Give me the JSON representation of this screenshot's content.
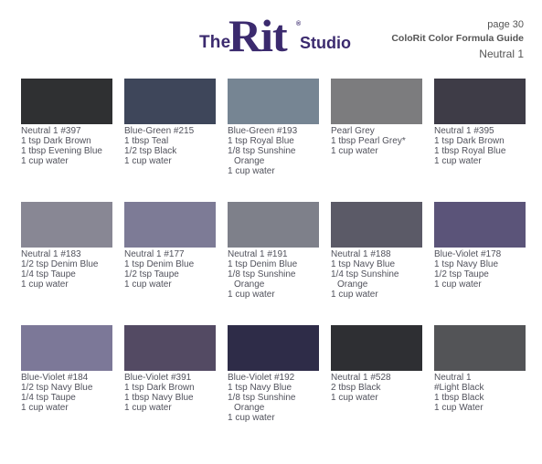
{
  "header": {
    "logo": {
      "the": "The",
      "rit": "Rit",
      "reg": "®",
      "studio": "Studio"
    },
    "page_number": "page 30",
    "guide_title": "ColoRit Color Formula Guide",
    "section": "Neutral 1"
  },
  "swatches": [
    {
      "name": "Neutral 1 #397",
      "color": "#2f3032",
      "lines": [
        {
          "text": "1 tsp Dark Brown",
          "indent": false
        },
        {
          "text": "1 tbsp Evening Blue",
          "indent": false
        },
        {
          "text": "1 cup water",
          "indent": false
        }
      ]
    },
    {
      "name": "Blue-Green #215",
      "color": "#3e465a",
      "lines": [
        {
          "text": "1 tbsp Teal",
          "indent": false
        },
        {
          "text": "1/2 tsp Black",
          "indent": false
        },
        {
          "text": "1 cup water",
          "indent": false
        }
      ]
    },
    {
      "name": "Blue-Green #193",
      "color": "#768593",
      "lines": [
        {
          "text": "1 tsp Royal Blue",
          "indent": false
        },
        {
          "text": "1/8 tsp Sunshine",
          "indent": false
        },
        {
          "text": "Orange",
          "indent": true
        },
        {
          "text": "1 cup water",
          "indent": false
        }
      ]
    },
    {
      "name": "Pearl Grey",
      "color": "#7c7c7e",
      "lines": [
        {
          "text": "1 tbsp Pearl Grey*",
          "indent": false
        },
        {
          "text": "1 cup water",
          "indent": false
        }
      ]
    },
    {
      "name": "Neutral 1 #395",
      "color": "#3e3c47",
      "lines": [
        {
          "text": "1 tsp Dark Brown",
          "indent": false
        },
        {
          "text": "1 tbsp Royal Blue",
          "indent": false
        },
        {
          "text": "1 cup water",
          "indent": false
        }
      ]
    },
    {
      "name": "Neutral 1 #183",
      "color": "#888794",
      "lines": [
        {
          "text": "1/2 tsp Denim Blue",
          "indent": false
        },
        {
          "text": "1/4 tsp Taupe",
          "indent": false
        },
        {
          "text": "1 cup water",
          "indent": false
        }
      ]
    },
    {
      "name": "Neutral 1 #177",
      "color": "#7d7b96",
      "lines": [
        {
          "text": "1 tsp Denim Blue",
          "indent": false
        },
        {
          "text": "1/2 tsp Taupe",
          "indent": false
        },
        {
          "text": "1 cup water",
          "indent": false
        }
      ]
    },
    {
      "name": "Neutral 1 #191",
      "color": "#7e808a",
      "lines": [
        {
          "text": "1 tsp Denim Blue",
          "indent": false
        },
        {
          "text": "1/8 tsp Sunshine",
          "indent": false
        },
        {
          "text": "Orange",
          "indent": true
        },
        {
          "text": "1 cup water",
          "indent": false
        }
      ]
    },
    {
      "name": "Neutral 1 #188",
      "color": "#5b5a67",
      "lines": [
        {
          "text": "1 tsp Navy Blue",
          "indent": false
        },
        {
          "text": "1/4 tsp Sunshine",
          "indent": false
        },
        {
          "text": "Orange",
          "indent": true
        },
        {
          "text": "1 cup water",
          "indent": false
        }
      ]
    },
    {
      "name": "Blue-Violet #178",
      "color": "#5b5479",
      "lines": [
        {
          "text": "1 tsp Navy Blue",
          "indent": false
        },
        {
          "text": "1/2 tsp Taupe",
          "indent": false
        },
        {
          "text": "1 cup water",
          "indent": false
        }
      ]
    },
    {
      "name": "Blue-Violet #184",
      "color": "#7c7898",
      "lines": [
        {
          "text": "1/2 tsp Navy Blue",
          "indent": false
        },
        {
          "text": "1/4 tsp Taupe",
          "indent": false
        },
        {
          "text": "1 cup water",
          "indent": false
        }
      ]
    },
    {
      "name": "Blue-Violet #391",
      "color": "#534a63",
      "lines": [
        {
          "text": "1 tsp Dark Brown",
          "indent": false
        },
        {
          "text": "1 tbsp Navy Blue",
          "indent": false
        },
        {
          "text": "1 cup water",
          "indent": false
        }
      ]
    },
    {
      "name": "Blue-Violet #192",
      "color": "#2e2c48",
      "lines": [
        {
          "text": "1 tsp Navy Blue",
          "indent": false
        },
        {
          "text": "1/8 tsp Sunshine",
          "indent": false
        },
        {
          "text": "Orange",
          "indent": true
        },
        {
          "text": "1 cup water",
          "indent": false
        }
      ]
    },
    {
      "name": "Neutral 1 #528",
      "color": "#2e2f33",
      "lines": [
        {
          "text": "2 tbsp Black",
          "indent": false
        },
        {
          "text": "1 cup water",
          "indent": false
        }
      ]
    },
    {
      "name": "Neutral 1",
      "color": "#535457",
      "lines": [
        {
          "text": "#Light Black",
          "indent": false
        },
        {
          "text": "1 tbsp Black",
          "indent": false
        },
        {
          "text": "1 cup Water",
          "indent": false
        }
      ]
    }
  ]
}
